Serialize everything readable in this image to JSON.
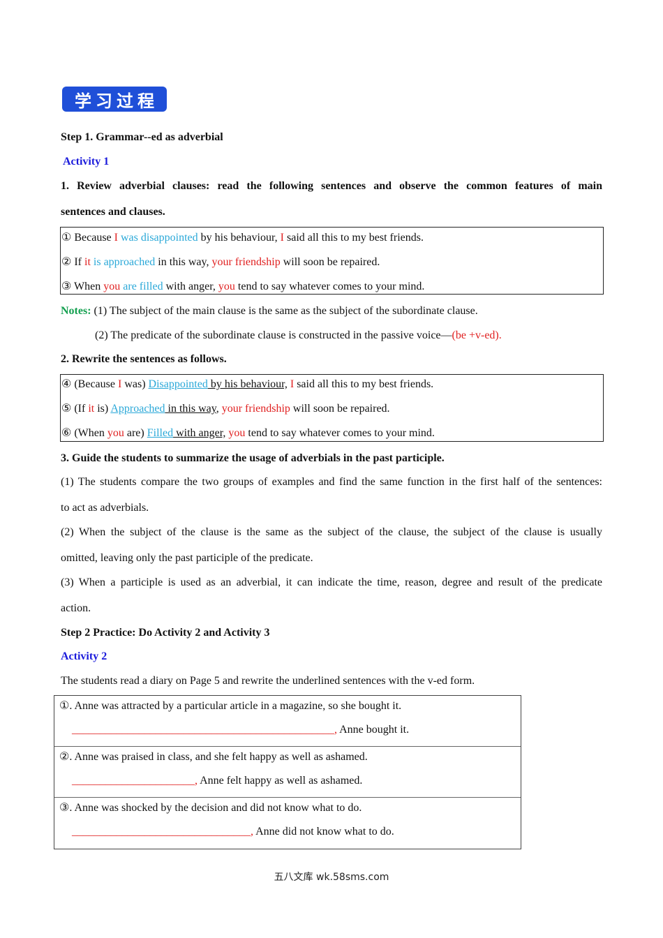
{
  "banner": {
    "label": "学习过程"
  },
  "step1": {
    "title": "Step 1. Grammar--ed as adverbial"
  },
  "activity1": {
    "title": "Activity 1"
  },
  "review": {
    "line1": "1. Review adverbial clauses: read the following sentences and observe the common features of main",
    "line2": "sentences and clauses."
  },
  "box1": [
    {
      "num": "①",
      "a": " Because ",
      "subj": "I",
      "verb": " was disappointed",
      "rest1": " by his behaviour, ",
      "subj2": "I",
      "rest2": " said all this to my best friends."
    },
    {
      "num": "②",
      "a": " If ",
      "subj": "it",
      "verb": " is approached",
      "rest1": " in this way, ",
      "subj2": "your friendship",
      "rest2": " will soon be repaired."
    },
    {
      "num": "③",
      "a": " When ",
      "subj": "you",
      "verb": " are filled",
      "rest1": " with anger, ",
      "subj2": "you",
      "rest2": " tend to say whatever comes to your mind."
    }
  ],
  "notes": {
    "label": "Notes:",
    "n1": " (1) The subject of the main clause is the same as the subject of the subordinate clause.",
    "n2": "(2) The predicate of the subordinate clause is constructed in the passive voice—",
    "n2_highlight": "(be +v-ed)."
  },
  "rewrite": {
    "title": "2. Rewrite the sentences as follows."
  },
  "box2": [
    {
      "num": "④",
      "pre": " (Because ",
      "subj": "I",
      "mid": " was) ",
      "verb": "Disappointed",
      "ul": " by his behaviour,",
      "sp": " ",
      "subj2": "I",
      "rest": " said all this to my best friends."
    },
    {
      "num": "⑤",
      "pre": " (If ",
      "subj": "it",
      "mid": " is) ",
      "verb": "Approached",
      "ul": " in this way",
      "sp": ", ",
      "subj2": "your friendship",
      "rest": " will soon be repaired."
    },
    {
      "num": "⑥",
      "pre": " (When ",
      "subj": "you",
      "mid": " are) ",
      "verb": "Filled",
      "ul": " with anger,",
      "sp": " ",
      "subj2": "you",
      "rest": " tend to say whatever comes to your mind."
    }
  ],
  "guide": {
    "title": "3. Guide the students to summarize the usage of adverbials in the past participle.",
    "p1a": "(1) The students compare the two groups of examples and find the same function in the first half of the sentences:",
    "p1b": "to act as adverbials.",
    "p2a": "(2) When the subject of the clause is the same as the subject of the clause, the subject of the clause is usually",
    "p2b": "omitted, leaving only the past participle of the predicate.",
    "p3a": "(3) When a participle is used as an adverbial, it can indicate the time, reason, degree and result of the predicate",
    "p3b": "action."
  },
  "step2": {
    "title": "Step 2 Practice: Do Activity 2 and Activity 3"
  },
  "activity2": {
    "title": "Activity 2",
    "instruction": "The students read a diary on Page 5 and rewrite the underlined sentences with the v-ed form.",
    "items": [
      {
        "question": "①. Anne was attracted by a particular article in a magazine, so she bought it.",
        "blank": "_______________________________________________,",
        "answer_tail": " Anne bought it."
      },
      {
        "question": "②. Anne was praised in class, and she felt happy as well as ashamed.",
        "blank": "______________________,",
        "answer_tail": " Anne felt happy as well as ashamed."
      },
      {
        "question": "③. Anne was shocked by the decision and did not know what to do.",
        "blank": "________________________________,",
        "answer_tail": " Anne did not know what to do."
      }
    ]
  },
  "footer": {
    "text": "五八文库 wk.58sms.com"
  }
}
